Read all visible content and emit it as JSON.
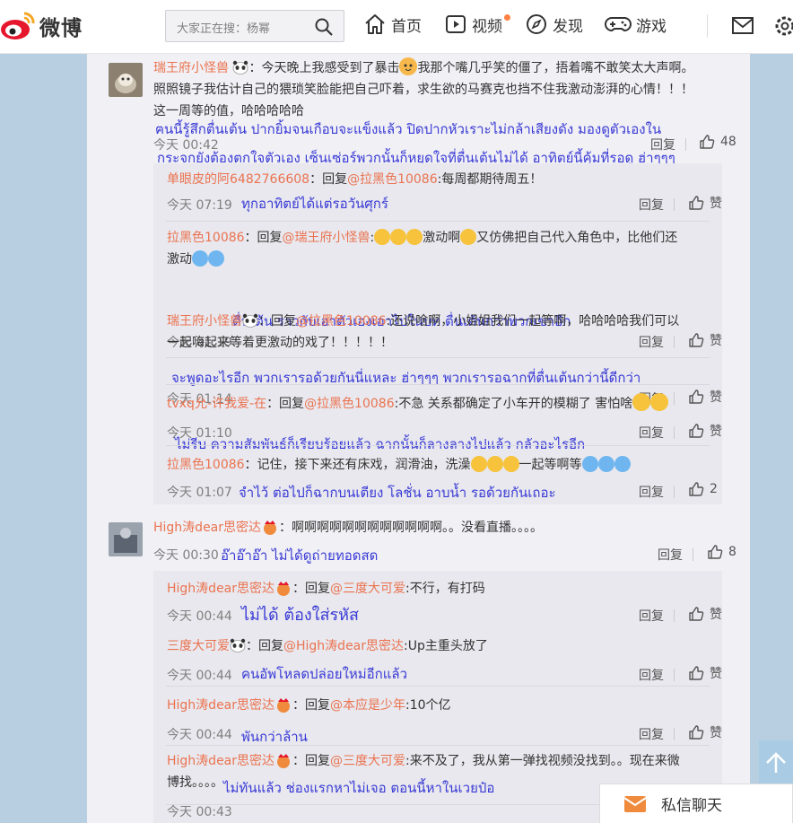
{
  "header": {
    "logo_text": "微博",
    "search_placeholder": "大家正在搜：杨幂",
    "nav": [
      {
        "label": "首页"
      },
      {
        "label": "视频"
      },
      {
        "label": "发现"
      },
      {
        "label": "游戏"
      }
    ]
  },
  "comments": [
    {
      "user": "瑞王府小怪兽",
      "text_line1": "：今天晚上我感受到了暴击",
      "text_line1b": "我那个嘴几乎笑的僵了，捂着嘴不敢笑太大声啊。",
      "text_line2": "照照镜子我估计自己的猥琐笑脸能把自己吓着，求生欲的马赛克也挡不住我激动澎湃的心情！！！",
      "text_line3": "这一周等的值，哈哈哈哈哈",
      "time": "今天 00:42",
      "reply": "回复",
      "likes": "48",
      "thai_1": "ฅนนี้รู้สึกตื่นเต้น ปากยิ้มจนเกือบจะแข็งแล้ว ปิดปากหัวเราะไม่กล้าเสียงดัง มองดูตัวเองใน",
      "thai_2": "กระจกยังต้องตกใจตัวเอง  เซ็นเซ่อร์พวกนั้นก็หยุดใจที่ตื่นเต้นไม่ได้ อาทิตย์นี้คุ้มที่รอดู ฮ่าๆๆๆ",
      "replies": [
        {
          "user": "单眼皮的阿6482766608",
          "prefix": "：回复",
          "at": "@拉黑色10086",
          "text": ":每周都期待周五！",
          "time": "今天 07:19",
          "thai": "ทุกอาทิตย์ได้แต่รอวันศุกร์",
          "reply": "回复",
          "like": "赞"
        },
        {
          "user": "拉黑色10086",
          "prefix": "：回复",
          "at": "@瑞王府小怪兽",
          "text": ":",
          "text_b": "激动啊",
          "text_c": "又仿佛把自己代入角色中，比他们还",
          "text_line2": "激动",
          "time": "今天 01:19",
          "thai": "ตื่นเต้น ราวกับเอาตัวเองเอาไปในบท ตื่นเต้นกว่าพวกเขาอีก",
          "reply": "回复",
          "like": "赞"
        },
        {
          "user": "瑞王府小怪兽",
          "prefix": "：回复",
          "at": "@拉黑色10086",
          "text": ":还说啥啊，小姐姐我们一起等啊，哈哈哈哈我们可以",
          "text_line2": "一起嗨起来等着更激动的戏了！！！！！",
          "time": "今天 01:14",
          "thai": "จะพูดอะไรอีก  พวกเรารอด้วยกันนี่แหละ  ฮ่าๆๆๆ พวกเรารอฉากที่ตื่นเต้นกว่านี้ดีกว่า",
          "reply": "回复",
          "like": "赞"
        },
        {
          "user": "tvxq允-许我爱-在",
          "prefix": "：回复",
          "at": "@拉黑色10086",
          "text": ":不急 关系都确定了小车开的模糊了 害怕啥",
          "time": "今天 01:10",
          "thai": "ไม่รีบ ความสัมพันธ์ก็เรียบร้อยแล้ว ฉากนั้นก็ลางลางไปแล้ว  กลัวอะไรอีก",
          "reply": "回复",
          "like": "赞"
        },
        {
          "user": "拉黑色10086",
          "prefix": "：记住，接下来还有床戏，润滑油，洗澡",
          "text_b": "一起等啊等",
          "time": "今天 01:07",
          "thai": "จำไว้ ต่อไปก็ฉากบนเตียง โลชั่น อาบน้ำ รอด้วยกันเถอะ",
          "reply": "回复",
          "likes": "2"
        }
      ]
    },
    {
      "user": "High涛dear思密达",
      "text": "：啊啊啊啊啊啊啊啊啊啊啊啊。。没看直播。。。。",
      "time": "今天 00:30",
      "thai": "อ๊าอ๊าอ๊า ไม่ได้ดูถ่ายทอดสด",
      "reply": "回复",
      "likes": "8",
      "replies": [
        {
          "user": "High涛dear思密达",
          "prefix": "：回复",
          "at": "@三度大可爱",
          "text": ":不行，有打码",
          "time": "今天 00:44",
          "thai": "ไม่ได้ ต้องใส่รหัส",
          "reply": "回复",
          "like": "赞"
        },
        {
          "user": "三度大可爱",
          "prefix": "：回复",
          "at": "@High涛dear思密达",
          "text": ":Up主重头放了",
          "time": "今天 00:44",
          "thai": "คนอัพโหลดปล่อยใหม่อีกแล้ว",
          "reply": "回复",
          "like": "赞"
        },
        {
          "user": "High涛dear思密达",
          "prefix": "：回复",
          "at": "@本应是少年",
          "text": ":10个亿",
          "time": "今天 00:44",
          "thai": "พันกว่าล้าน",
          "reply": "回复",
          "like": "赞"
        },
        {
          "user": "High涛dear思密达",
          "prefix": "：回复",
          "at": "@三度大可爱",
          "text": ":来不及了，我从第一弹找视频没找到。。现在来微",
          "text_line2": "博找。。。。",
          "time": "今天 00:43",
          "thai": "ไม่ทันแล้ว ช่องแรกหาไม่เจอ ตอนนี้หาในเวยป๋อ"
        }
      ]
    }
  ],
  "dm": {
    "label": "私信聊天"
  }
}
